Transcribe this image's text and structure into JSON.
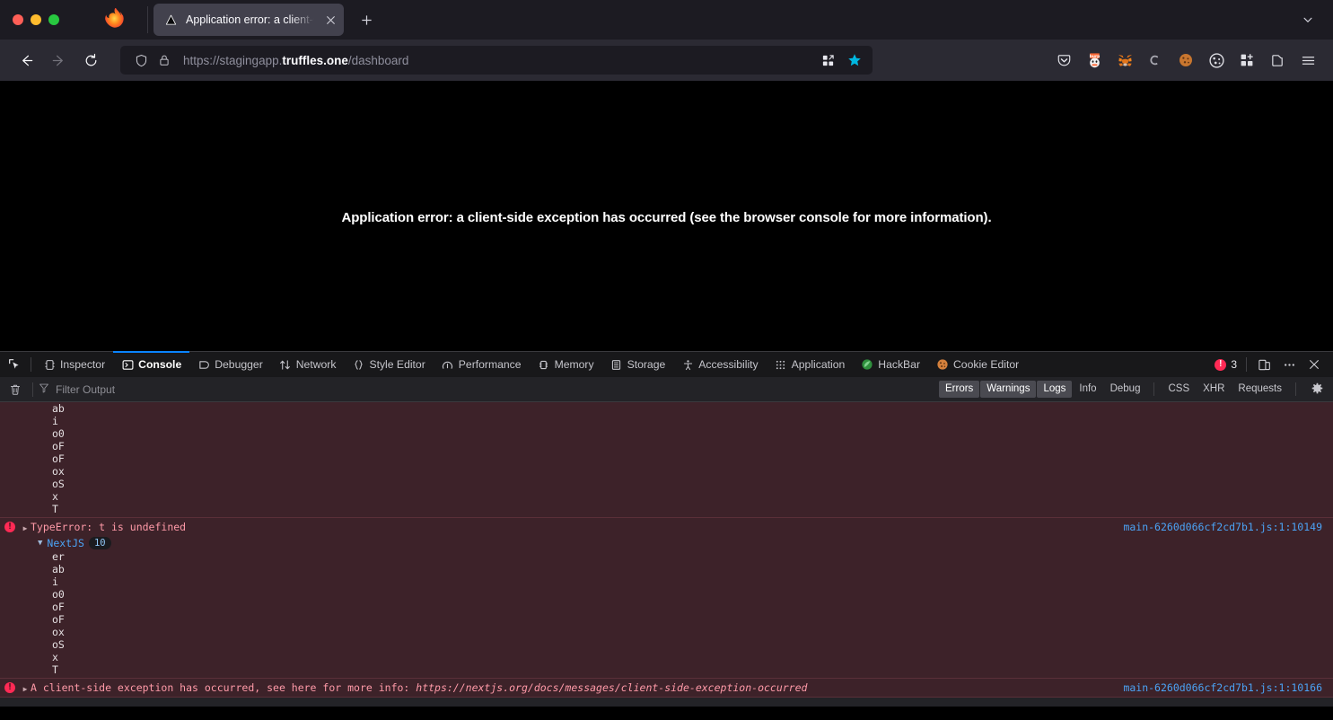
{
  "browser": {
    "window_controls": [
      "close",
      "minimize",
      "maximize"
    ],
    "tab": {
      "title": "Application error: a client-side e",
      "favicon": "nextjs-triangle-icon",
      "close_label": "✕"
    },
    "new_tab_label": "+",
    "list_all_tabs_label": "⌄",
    "nav": {
      "back_label": "←",
      "forward_label": "→",
      "reload_label": "↻"
    },
    "url": {
      "scheme": "https://",
      "subdomain": "stagingapp.",
      "domain": "truffles.one",
      "path": "/dashboard",
      "full": "https://stagingapp.truffles.one/dashboard",
      "shield_icon": "shield-icon",
      "lock_icon": "lock-icon"
    },
    "urlbar_actions": [
      {
        "name": "split-view-icon",
        "label": ""
      },
      {
        "name": "bookmark-star-icon",
        "label": "",
        "color": "#00b7e0"
      }
    ],
    "toolbar_icons": [
      {
        "name": "pocket-icon",
        "label": "Pocket"
      },
      {
        "name": "burp-suite-icon",
        "label": "Burp Suite"
      },
      {
        "name": "metamask-fox-icon",
        "label": "MetaMask"
      },
      {
        "name": "loop-extension-icon",
        "label": "Loop"
      },
      {
        "name": "cookie-quick-manager-icon",
        "label": "Cookie Quick Manager"
      },
      {
        "name": "cookie-editor-icon",
        "label": "Cookie Editor"
      },
      {
        "name": "extensions-grid-icon",
        "label": "Extensions"
      },
      {
        "name": "container-tabs-icon",
        "label": "Container Tabs"
      },
      {
        "name": "app-menu-icon",
        "label": "Open application menu"
      }
    ]
  },
  "page": {
    "error_text": "Application error: a client-side exception has occurred (see the browser console for more information)."
  },
  "devtools": {
    "picker_icon": "element-picker-icon",
    "tabs": [
      {
        "label": "Inspector",
        "icon": "inspector-icon",
        "active": false
      },
      {
        "label": "Console",
        "icon": "console-icon",
        "active": true
      },
      {
        "label": "Debugger",
        "icon": "debugger-icon",
        "active": false
      },
      {
        "label": "Network",
        "icon": "network-icon",
        "active": false
      },
      {
        "label": "Style Editor",
        "icon": "style-editor-icon",
        "active": false
      },
      {
        "label": "Performance",
        "icon": "performance-icon",
        "active": false
      },
      {
        "label": "Memory",
        "icon": "memory-icon",
        "active": false
      },
      {
        "label": "Storage",
        "icon": "storage-icon",
        "active": false
      },
      {
        "label": "Accessibility",
        "icon": "accessibility-icon",
        "active": false
      },
      {
        "label": "Application",
        "icon": "application-icon",
        "active": false
      },
      {
        "label": "HackBar",
        "icon": "hackbar-icon",
        "active": false
      },
      {
        "label": "Cookie Editor",
        "icon": "cookie-editor-icon",
        "active": false
      }
    ],
    "error_count": "3",
    "error_badge_glyph": "!",
    "responsive_icon": "responsive-design-mode-icon",
    "meatball_icon": "more-options-icon",
    "close_icon": "close-devtools-icon",
    "filterbar": {
      "trash_icon": "clear-console-icon",
      "filter_icon": "funnel-icon",
      "filter_placeholder": "Filter Output",
      "filter_value": "",
      "buttons": [
        {
          "label": "Errors",
          "active": true
        },
        {
          "label": "Warnings",
          "active": true
        },
        {
          "label": "Logs",
          "active": true
        },
        {
          "label": "Info",
          "active": false
        },
        {
          "label": "Debug",
          "active": false
        }
      ],
      "buttons2": [
        {
          "label": "CSS",
          "active": false
        },
        {
          "label": "XHR",
          "active": false
        },
        {
          "label": "Requests",
          "active": false
        }
      ],
      "settings_icon": "gear-icon"
    },
    "console": {
      "scrolled_stack_top": {
        "frames": [
          "ab",
          "i",
          "o0",
          "oF",
          "oF",
          "ox",
          "oS",
          "x",
          "T"
        ]
      },
      "messages": [
        {
          "level": "error",
          "expander": "▶",
          "text": "TypeError: t is undefined",
          "source": "main-6260d066cf2cd7b1.js:1:10149",
          "group": {
            "expander": "▼",
            "name": "NextJS",
            "count": "10",
            "frames": [
              "er",
              "ab",
              "i",
              "o0",
              "oF",
              "oF",
              "ox",
              "oS",
              "x",
              "T"
            ]
          }
        },
        {
          "level": "error",
          "expander": "▶",
          "text": "A client-side exception has occurred, see here for more info: ",
          "link": "https://nextjs.org/docs/messages/client-side-exception-occurred",
          "source": "main-6260d066cf2cd7b1.js:1:10166"
        }
      ]
    }
  }
}
